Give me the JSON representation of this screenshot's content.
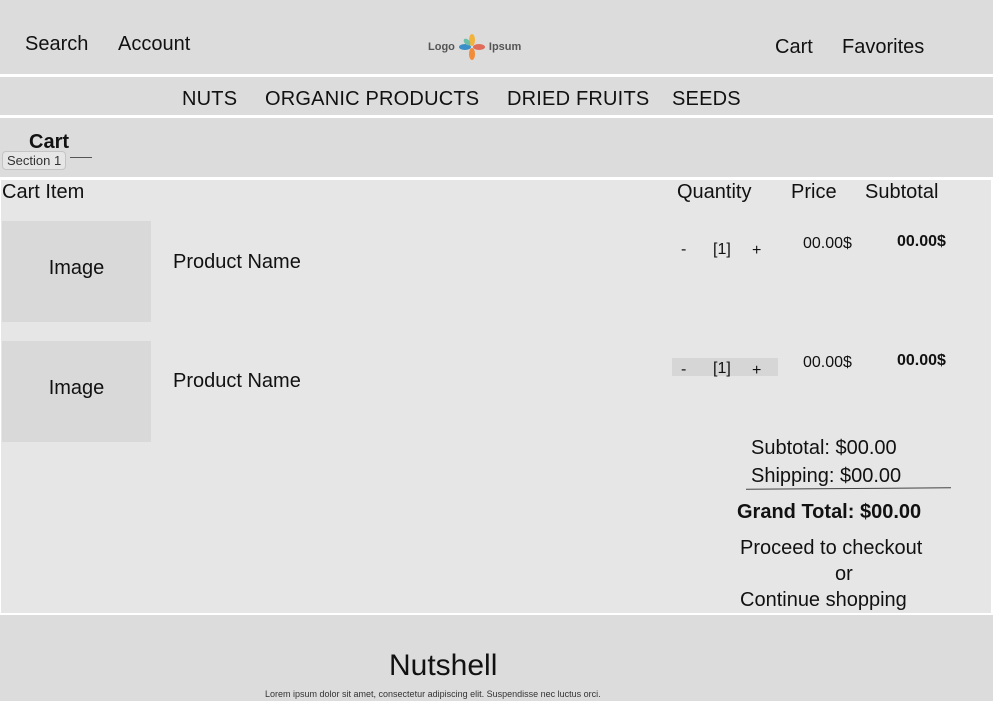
{
  "header": {
    "search_label": "Search",
    "account_label": "Account",
    "logo_text_left": "Logo",
    "logo_text_right": "Ipsum",
    "cart_label": "Cart",
    "favorites_label": "Favorites"
  },
  "nav": {
    "items": [
      {
        "label": "NUTS"
      },
      {
        "label": "ORGANIC PRODUCTS"
      },
      {
        "label": "DRIED FRUITS"
      },
      {
        "label": "SEEDS"
      }
    ]
  },
  "page": {
    "title": "Cart",
    "section_tag": "Section 1"
  },
  "table": {
    "headers": {
      "item": "Cart Item",
      "quantity": "Quantity",
      "price": "Price",
      "subtotal": "Subtotal"
    },
    "rows": [
      {
        "image_label": "Image",
        "product_name": "Product Name",
        "minus": "-",
        "qty": "[1]",
        "plus": "+",
        "price": "00.00$",
        "subtotal": "00.00$"
      },
      {
        "image_label": "Image",
        "product_name": "Product Name",
        "minus": "-",
        "qty": "[1]",
        "plus": "+",
        "price": "00.00$",
        "subtotal": "00.00$"
      }
    ]
  },
  "summary": {
    "subtotal": "Subtotal: $00.00",
    "shipping": "Shipping: $00.00",
    "grand_total": "Grand Total: $00.00",
    "checkout": "Proceed to checkout",
    "or": "or",
    "continue": "Continue shopping"
  },
  "footer": {
    "brand": "Nutshell",
    "text": "Lorem ipsum dolor sit amet, consectetur adipiscing elit. Suspendisse nec luctus orci."
  },
  "colors": {
    "band": "#dcdcdc",
    "cart_bg": "#e6e6e6",
    "image_box": "#d9d9d9"
  }
}
